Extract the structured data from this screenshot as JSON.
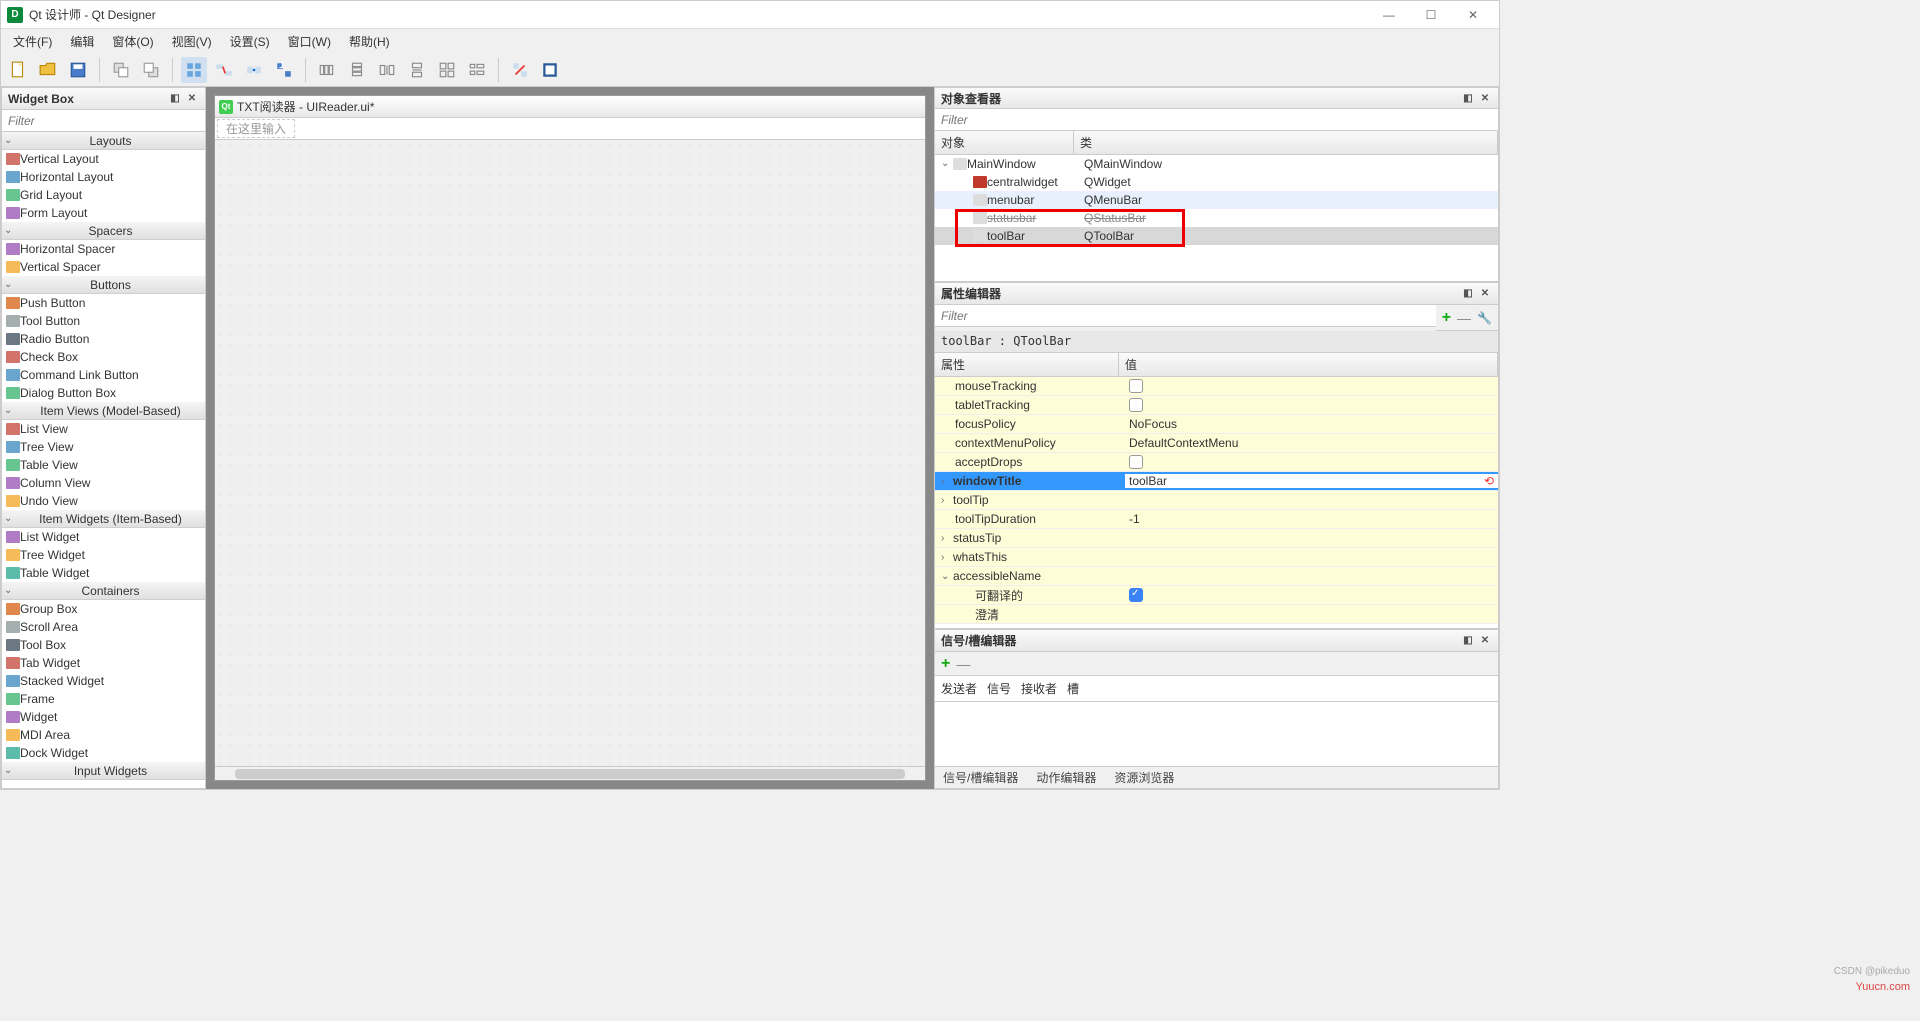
{
  "titlebar": {
    "app_name": "Qt 设计师 - Qt Designer"
  },
  "menus": [
    "文件(F)",
    "编辑",
    "窗体(O)",
    "视图(V)",
    "设置(S)",
    "窗口(W)",
    "帮助(H)"
  ],
  "widgetbox": {
    "title": "Widget Box",
    "filter": "Filter",
    "categories": [
      {
        "name": "Layouts",
        "items": [
          "Vertical Layout",
          "Horizontal Layout",
          "Grid Layout",
          "Form Layout"
        ]
      },
      {
        "name": "Spacers",
        "items": [
          "Horizontal Spacer",
          "Vertical Spacer"
        ]
      },
      {
        "name": "Buttons",
        "items": [
          "Push Button",
          "Tool Button",
          "Radio Button",
          "Check Box",
          "Command Link Button",
          "Dialog Button Box"
        ]
      },
      {
        "name": "Item Views (Model-Based)",
        "items": [
          "List View",
          "Tree View",
          "Table View",
          "Column View",
          "Undo View"
        ]
      },
      {
        "name": "Item Widgets (Item-Based)",
        "items": [
          "List Widget",
          "Tree Widget",
          "Table Widget"
        ]
      },
      {
        "name": "Containers",
        "items": [
          "Group Box",
          "Scroll Area",
          "Tool Box",
          "Tab Widget",
          "Stacked Widget",
          "Frame",
          "Widget",
          "MDI Area",
          "Dock Widget"
        ]
      },
      {
        "name": "Input Widgets",
        "items": []
      }
    ]
  },
  "form": {
    "tab_title": "TXT阅读器 - UIReader.ui*",
    "toolbar_hint": "在这里输入"
  },
  "object_inspector": {
    "title": "对象查看器",
    "filter": "Filter",
    "columns": [
      "对象",
      "类"
    ],
    "rows": [
      {
        "name": "MainWindow",
        "cls": "QMainWindow",
        "depth": 0,
        "exp": "⌄"
      },
      {
        "name": "centralwidget",
        "cls": "QWidget",
        "depth": 1,
        "icon": "#c0392b"
      },
      {
        "name": "menubar",
        "cls": "QMenuBar",
        "depth": 1,
        "hl": true
      },
      {
        "name": "statusbar",
        "cls": "QStatusBar",
        "depth": 1,
        "strike": true
      },
      {
        "name": "toolBar",
        "cls": "QToolBar",
        "depth": 1,
        "sel": true
      }
    ]
  },
  "property_editor": {
    "title": "属性编辑器",
    "filter": "Filter",
    "object_label": "toolBar : QToolBar",
    "columns": [
      "属性",
      "值"
    ],
    "rows": [
      {
        "name": "mouseTracking",
        "value_chk": false
      },
      {
        "name": "tabletTracking",
        "value_chk": false
      },
      {
        "name": "focusPolicy",
        "value": "NoFocus"
      },
      {
        "name": "contextMenuPolicy",
        "value": "DefaultContextMenu"
      },
      {
        "name": "acceptDrops",
        "value_chk": false
      },
      {
        "name": "windowTitle",
        "value": "toolBar",
        "exp": "›",
        "bold": true,
        "sel": true
      },
      {
        "name": "toolTip",
        "value": "",
        "exp": "›"
      },
      {
        "name": "toolTipDuration",
        "value": "-1"
      },
      {
        "name": "statusTip",
        "value": "",
        "exp": "›"
      },
      {
        "name": "whatsThis",
        "value": "",
        "exp": "›"
      },
      {
        "name": "accessibleName",
        "value": "",
        "exp": "⌄"
      },
      {
        "name": "可翻译的",
        "value_chk": true,
        "child": true
      },
      {
        "name": "澄清",
        "value": "",
        "child": true
      }
    ]
  },
  "signal_editor": {
    "title": "信号/槽编辑器",
    "columns": [
      "发送者",
      "信号",
      "接收者",
      "槽"
    ]
  },
  "bottom_tabs": [
    "信号/槽编辑器",
    "动作编辑器",
    "资源浏览器"
  ],
  "watermark": "Yuucn.com",
  "watermark2": "CSDN @pikeduo"
}
